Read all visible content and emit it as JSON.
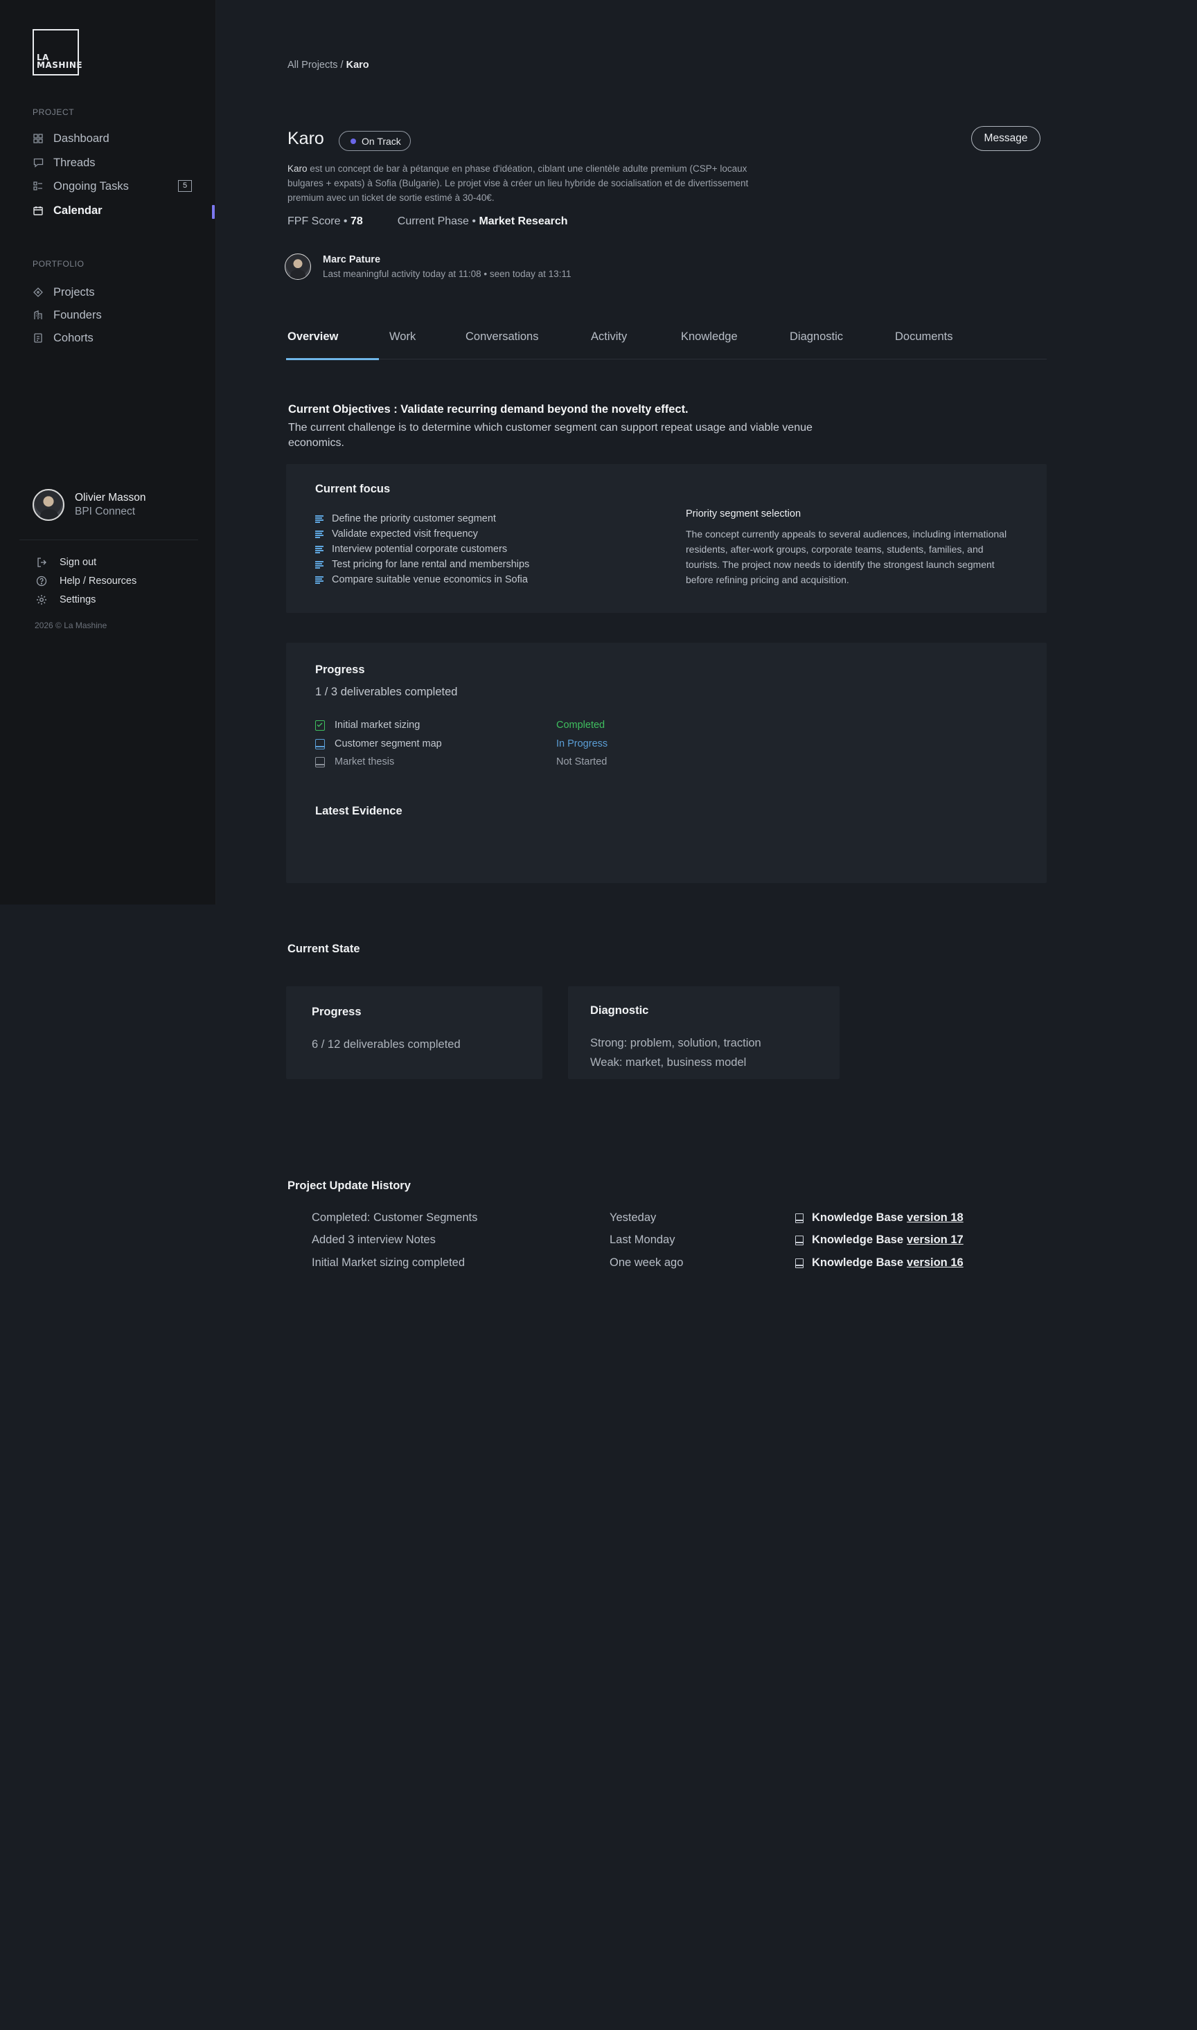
{
  "logo": {
    "line1": "LA",
    "line2": "MASHINE"
  },
  "sidebar": {
    "project_label": "PROJECT",
    "project_items": [
      {
        "label": "Dashboard",
        "icon": "grid-icon"
      },
      {
        "label": "Threads",
        "icon": "chat-bubble-icon"
      },
      {
        "label": "Ongoing Tasks",
        "icon": "task-list-icon",
        "badge": "5"
      },
      {
        "label": "Calendar",
        "icon": "calendar-icon",
        "active": true
      }
    ],
    "portfolio_label": "PORTFOLIO",
    "portfolio_items": [
      {
        "label": "Projects",
        "icon": "diamond-icon"
      },
      {
        "label": "Founders",
        "icon": "founders-icon"
      },
      {
        "label": "Cohorts",
        "icon": "clipboard-icon"
      }
    ],
    "user": {
      "name": "Olivier Masson",
      "org": "BPI Connect"
    },
    "utilities": [
      {
        "label": "Sign out",
        "icon": "sign-out-icon"
      },
      {
        "label": "Help / Resources",
        "icon": "help-circle-icon"
      },
      {
        "label": "Settings",
        "icon": "gear-icon"
      }
    ],
    "copyright": "2026 © La Mashine"
  },
  "breadcrumb": {
    "parent": "All Projects",
    "separator": " / ",
    "current": "Karo"
  },
  "project": {
    "title": "Karo",
    "status": "On Track",
    "status_color": "#6a66e8",
    "message_label": "Message",
    "description_name": "Karo",
    "description_rest": " est un concept de bar à pétanque en phase d'idéation, ciblant une clientèle adulte premium (CSP+ locaux bulgares + expats) à Sofia (Bulgarie). Le projet vise à créer un lieu hybride de socialisation et de divertissement premium avec un ticket de sortie estimé à 30-40€.",
    "fpf_label": "FPF Score",
    "fpf_value": "78",
    "phase_label": "Current Phase",
    "phase_value": "Market Research",
    "bullet": " • ",
    "owner_name": "Marc Pature",
    "owner_activity": "Last meaningful activity today at 11:08 •  seen today at 13:11"
  },
  "tabs": [
    "Overview",
    "Work",
    "Conversations",
    "Activity",
    "Knowledge",
    "Diagnostic",
    "Documents"
  ],
  "objectives": {
    "title": "Current Objectives : Validate recurring demand beyond the novelty effect.",
    "text": "The current challenge is to determine which customer segment can support repeat usage and viable venue economics."
  },
  "focus": {
    "title": "Current focus",
    "items": [
      "Define the priority customer segment",
      "Validate expected visit frequency",
      "Interview potential corporate customers",
      "Test pricing for lane rental and memberships",
      "Compare suitable venue economics in Sofia"
    ],
    "side_title": "Priority segment selection",
    "side_text": "The concept currently appeals to several audiences, including international residents, after-work groups, corporate teams, students, families, and tourists. The project now needs to identify the strongest launch segment before refining pricing and acquisition."
  },
  "progress": {
    "title": "Progress",
    "summary": "1 / 3 deliverables completed",
    "deliverables": [
      {
        "name": "Initial market sizing",
        "status": "Completed",
        "color": "#3fbf5f"
      },
      {
        "name": "Customer segment map",
        "status": "In Progress",
        "color": "#5b9ed6"
      },
      {
        "name": "Market thesis",
        "status": "Not Started",
        "color": "#8a9099"
      }
    ],
    "evidence_title": "Latest Evidence"
  },
  "current_state": {
    "title": "Current State",
    "progress_title": "Progress",
    "progress_value": "6 / 12 deliverables completed",
    "diagnostic_title": "Diagnostic",
    "diagnostic_strong": "Strong: problem, solution, traction",
    "diagnostic_weak": "Weak: market, business model"
  },
  "history": {
    "title": "Project Update History",
    "kb_label": "Knowledge Base",
    "rows": [
      {
        "label": "Completed: Customer Segments",
        "when": "Yesteday",
        "version": "version 18"
      },
      {
        "label": "Added 3 interview Notes",
        "when": "Last Monday",
        "version": "version 17"
      },
      {
        "label": "Initial Market sizing completed",
        "when": "One week ago",
        "version": "version 16"
      }
    ]
  }
}
